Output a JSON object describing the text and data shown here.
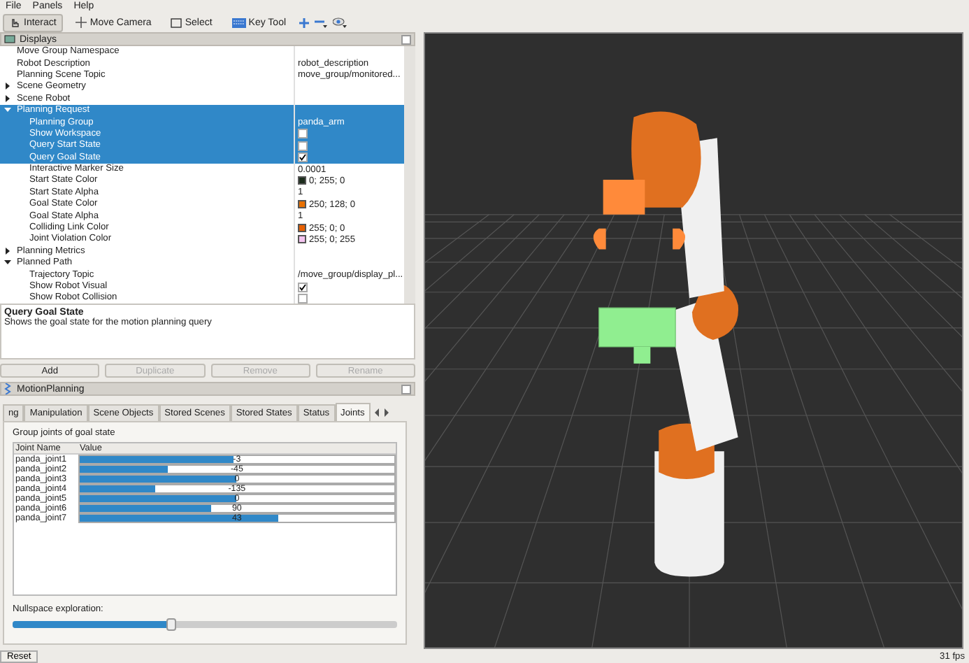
{
  "menu": [
    "File",
    "Panels",
    "Help"
  ],
  "toolbar": [
    {
      "label": "Interact",
      "kind": "interact",
      "selected": true
    },
    {
      "label": "Move Camera",
      "kind": "camera",
      "selected": false
    },
    {
      "label": "Select",
      "kind": "select",
      "selected": false
    },
    {
      "label": "Key Tool",
      "kind": "key",
      "selected": false
    }
  ],
  "displays": {
    "title": "Displays",
    "rows": [
      {
        "label": "Move Group Namespace",
        "selected": false
      },
      {
        "label": "Robot Description",
        "kind": "text",
        "value": "robot_description",
        "selected": false
      },
      {
        "label": "Planning Scene Topic",
        "kind": "text",
        "value": "move_group/monitored...",
        "selected": false
      },
      {
        "label": "Scene Geometry",
        "expanded": false,
        "selected": false
      },
      {
        "label": "Scene Robot",
        "expanded": false,
        "selected": false
      },
      {
        "label": "Planning Request",
        "expanded": true,
        "selected": true,
        "children": [
          {
            "label": "Planning Group",
            "kind": "text",
            "value": "panda_arm",
            "selected": true
          },
          {
            "label": "Show Workspace",
            "kind": "checkbox",
            "checked": false,
            "selected": true
          },
          {
            "label": "Query Start State",
            "kind": "checkbox",
            "checked": false,
            "selected": true
          },
          {
            "label": "Query Goal State",
            "kind": "checkbox",
            "checked": true,
            "selected": true
          },
          {
            "label": "Interactive Marker Size",
            "kind": "text",
            "value": "0.0001",
            "selected": false
          },
          {
            "label": "Start State Color",
            "kind": "color",
            "color": "#1c2c1c",
            "value": "0; 255; 0",
            "selected": false
          },
          {
            "label": "Start State Alpha",
            "kind": "text",
            "value": "1",
            "selected": false
          },
          {
            "label": "Goal State Color",
            "kind": "color",
            "color": "#e87000",
            "value": "250; 128; 0",
            "selected": false
          },
          {
            "label": "Goal State Alpha",
            "kind": "text",
            "value": "1",
            "selected": false
          },
          {
            "label": "Colliding Link Color",
            "kind": "color",
            "color": "#e86000",
            "value": "255; 0; 0",
            "selected": false
          },
          {
            "label": "Joint Violation Color",
            "kind": "color",
            "color": "#f4c4f0",
            "value": "255; 0; 255",
            "selected": false
          }
        ]
      },
      {
        "label": "Planning Metrics",
        "expanded": false,
        "selected": false
      },
      {
        "label": "Planned Path",
        "expanded": true,
        "selected": false,
        "children": [
          {
            "label": "Trajectory Topic",
            "kind": "text",
            "value": "/move_group/display_pl...",
            "selected": false
          },
          {
            "label": "Show Robot Visual",
            "kind": "checkbox",
            "checked": true,
            "selected": false
          },
          {
            "label": "Show Robot Collision",
            "kind": "checkbox",
            "checked": false,
            "selected": false
          }
        ]
      }
    ],
    "description": {
      "title": "Query Goal State",
      "text": "Shows the goal state for the motion planning query"
    },
    "buttons": [
      {
        "label": "Add",
        "disabled": false
      },
      {
        "label": "Duplicate",
        "disabled": true
      },
      {
        "label": "Remove",
        "disabled": true
      },
      {
        "label": "Rename",
        "disabled": true
      }
    ]
  },
  "motion_planning": {
    "title": "MotionPlanning",
    "tabs": [
      {
        "label": "ng",
        "selected": false
      },
      {
        "label": "Manipulation",
        "selected": false
      },
      {
        "label": "Scene Objects",
        "selected": false
      },
      {
        "label": "Stored Scenes",
        "selected": false
      },
      {
        "label": "Stored States",
        "selected": false
      },
      {
        "label": "Status",
        "selected": false
      },
      {
        "label": "Joints",
        "selected": true
      }
    ],
    "group_label": "Group joints of goal state",
    "columns": [
      "Joint Name",
      "Value"
    ],
    "joints": [
      {
        "name": "panda_joint1",
        "value": "-3",
        "level": 0.49
      },
      {
        "name": "panda_joint2",
        "value": "-45",
        "level": 0.28
      },
      {
        "name": "panda_joint3",
        "value": "0",
        "level": 0.5
      },
      {
        "name": "panda_joint4",
        "value": "-135",
        "level": 0.24
      },
      {
        "name": "panda_joint5",
        "value": "0",
        "level": 0.5
      },
      {
        "name": "panda_joint6",
        "value": "90",
        "level": 0.42
      },
      {
        "name": "panda_joint7",
        "value": "43",
        "level": 0.63
      }
    ],
    "nullspace": {
      "label": "Nullspace exploration:",
      "level": 0.41
    }
  },
  "reset": "Reset",
  "fps": "31 fps"
}
